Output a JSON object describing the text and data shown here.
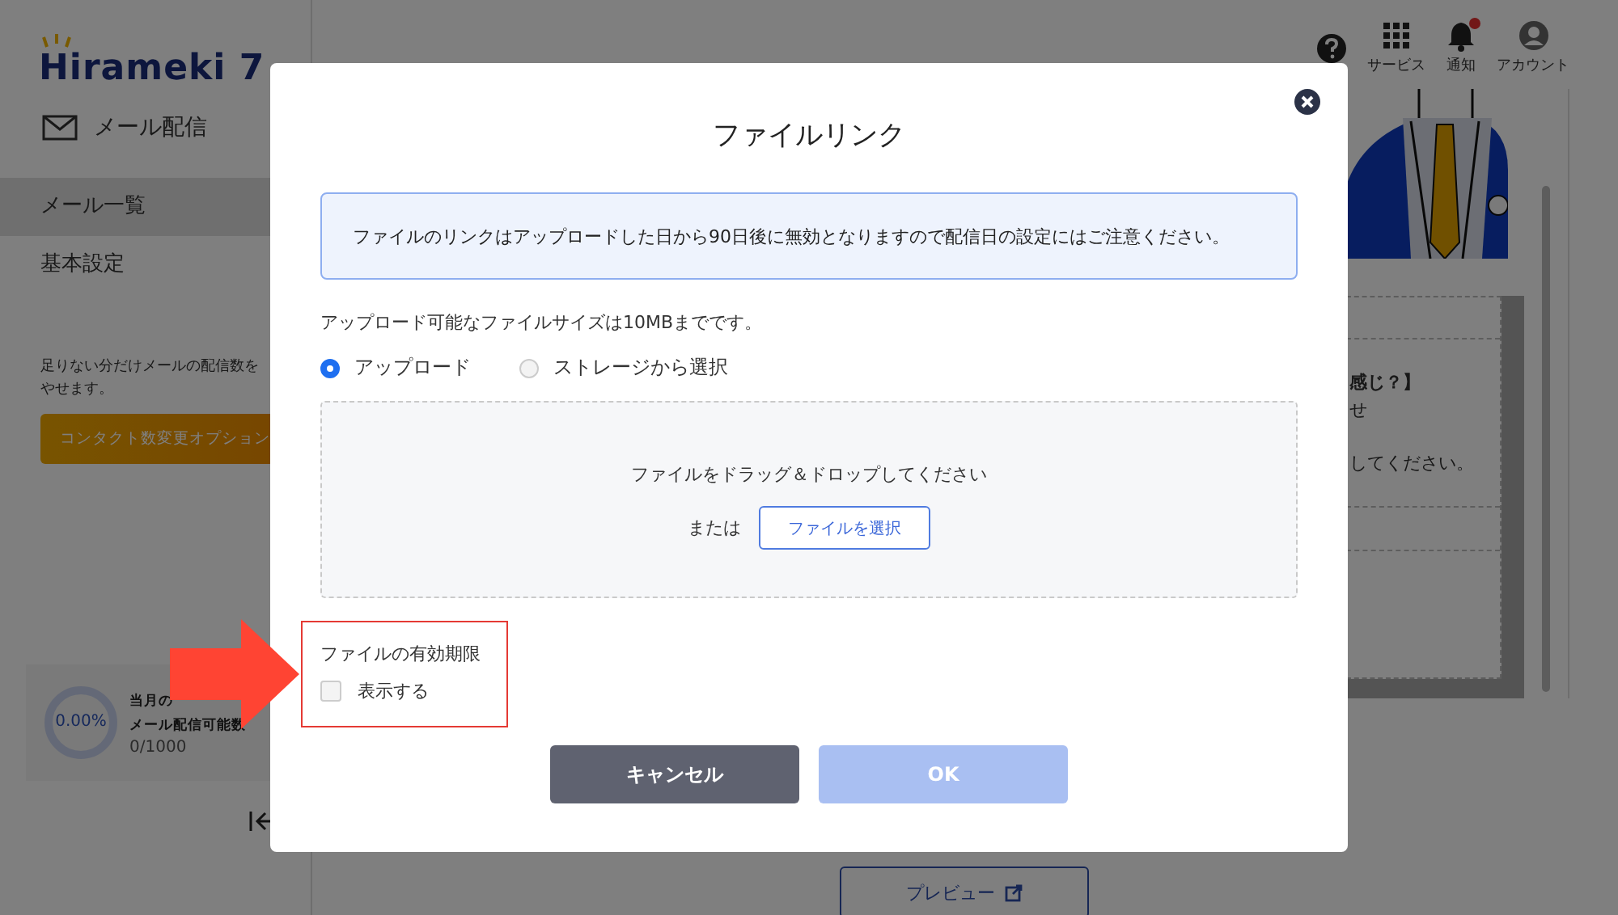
{
  "app": {
    "logo": "Hirameki 7"
  },
  "top_bar": {
    "items": [
      {
        "kind": "help",
        "badge": false
      },
      {
        "kind": "services",
        "label": "サービス",
        "badge": false
      },
      {
        "kind": "notifications",
        "label": "通知",
        "badge": true
      },
      {
        "kind": "account",
        "label": "アカウント",
        "badge": false
      }
    ]
  },
  "sidebar": {
    "section": "メール配信",
    "items": [
      {
        "label": "メール一覧",
        "selected": true
      },
      {
        "label": "基本設定",
        "selected": false
      }
    ],
    "promo_lines": [
      "足りない分だけメールの配信数を",
      "やせます。"
    ],
    "promo_button": "コンタクト数変更オプション",
    "usage": {
      "percent": "0.00%",
      "level": 0,
      "title_lines": [
        "当月の",
        "メール配信可能数"
      ],
      "count": "0/1000"
    }
  },
  "background_panel": {
    "lines": [
      {
        "text": "感じ？】",
        "bold": true
      },
      {
        "text": "せ",
        "bold": false
      },
      {
        "text": "してください。",
        "bold": false
      }
    ],
    "preview_button": "プレビュー"
  },
  "modal": {
    "title": "ファイルリンク",
    "notice": "ファイルのリンクはアップロードした日から90日後に無効となりますので配信日の設定にはご注意ください。",
    "size_note": "アップロード可能なファイルサイズは10MBまでです。",
    "sources": [
      {
        "label": "アップロード",
        "selected": true
      },
      {
        "label": "ストレージから選択",
        "selected": false
      }
    ],
    "dropzone": {
      "prompt": "ファイルをドラッグ＆ドロップしてください",
      "or": "または",
      "button": "ファイルを選択"
    },
    "expiry": {
      "title": "ファイルの有効期限",
      "checkbox": {
        "label": "表示する",
        "checked": false
      }
    },
    "buttons": [
      {
        "kind": "cancel",
        "label": "キャンセル",
        "disabled": false
      },
      {
        "kind": "ok",
        "label": "OK",
        "disabled": true
      }
    ]
  }
}
